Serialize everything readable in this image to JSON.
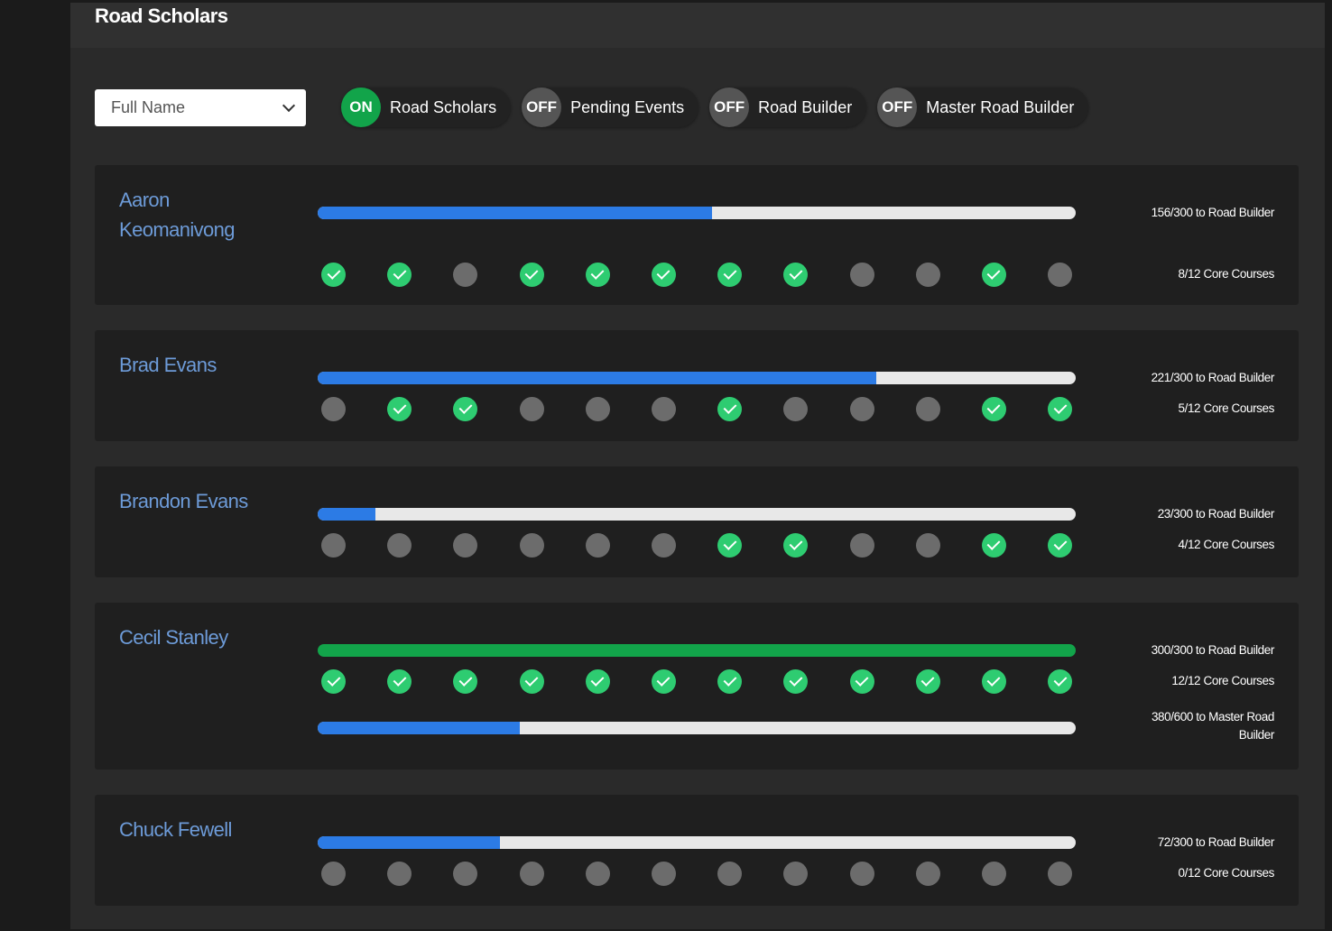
{
  "app": {
    "title": "Road Scholars"
  },
  "filter": {
    "select_value": "Full Name"
  },
  "toggles": [
    {
      "state": "ON",
      "label": "Road Scholars"
    },
    {
      "state": "OFF",
      "label": "Pending Events"
    },
    {
      "state": "OFF",
      "label": "Road Builder"
    },
    {
      "state": "OFF",
      "label": "Master Road Builder"
    }
  ],
  "people": [
    {
      "name": "Aaron Keomanivong",
      "road_builder_progress": 0.52,
      "road_builder_text": "156/300 to Road Builder",
      "courses": [
        1,
        1,
        0,
        1,
        1,
        1,
        1,
        1,
        0,
        0,
        1,
        0
      ],
      "courses_text": "8/12 Core Courses"
    },
    {
      "name": "Brad Evans",
      "road_builder_progress": 0.7367,
      "road_builder_text": "221/300 to Road Builder",
      "courses": [
        0,
        1,
        1,
        0,
        0,
        0,
        1,
        0,
        0,
        0,
        1,
        1
      ],
      "courses_text": "5/12 Core Courses"
    },
    {
      "name": "Brandon Evans",
      "road_builder_progress": 0.0767,
      "road_builder_text": "23/300 to Road Builder",
      "courses": [
        0,
        0,
        0,
        0,
        0,
        0,
        1,
        1,
        0,
        0,
        1,
        1
      ],
      "courses_text": "4/12 Core Courses"
    },
    {
      "name": "Cecil Stanley",
      "road_builder_progress": 1.0,
      "road_builder_text": "300/300 to Road Builder",
      "courses": [
        1,
        1,
        1,
        1,
        1,
        1,
        1,
        1,
        1,
        1,
        1,
        1
      ],
      "courses_text": "12/12 Core Courses",
      "master_progress": 0.2667,
      "master_text": "380/600 to Master Road Builder"
    },
    {
      "name": "Chuck Fewell",
      "road_builder_progress": 0.24,
      "road_builder_text": "72/300 to Road Builder",
      "courses": [
        0,
        0,
        0,
        0,
        0,
        0,
        0,
        0,
        0,
        0,
        0,
        0
      ],
      "courses_text": "0/12 Core Courses"
    }
  ]
}
